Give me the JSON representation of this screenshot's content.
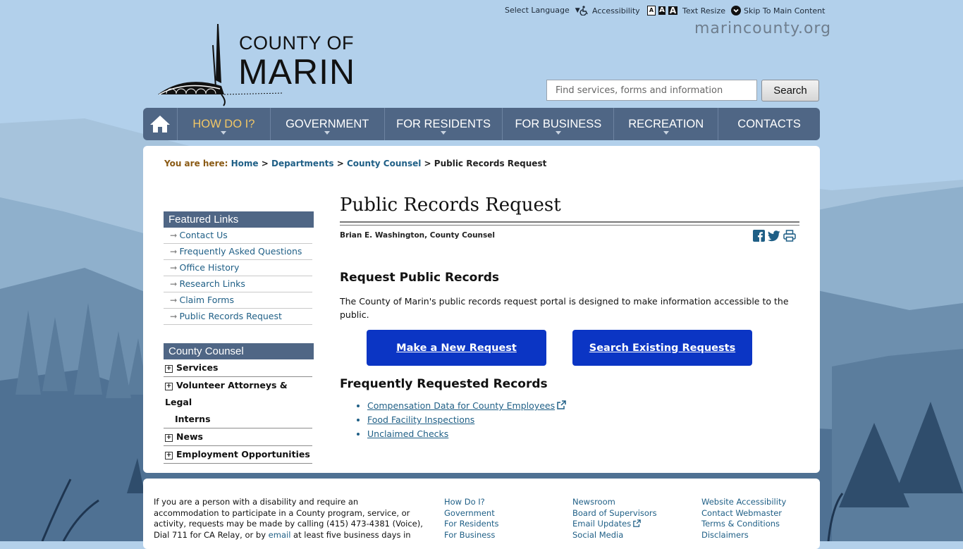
{
  "utility": {
    "language": "Select Language",
    "accessibility": "Accessibility",
    "text_resize": "Text Resize",
    "text_resize_letters": [
      "A",
      "A",
      "A"
    ],
    "skip": "Skip To Main Content"
  },
  "site": {
    "logo_line1": "COUNTY OF",
    "logo_line2": "MARIN",
    "domain": "marincounty.org"
  },
  "search": {
    "placeholder": "Find services, forms and information",
    "button": "Search"
  },
  "nav": {
    "home_icon": "home-icon",
    "items": [
      {
        "label": "HOW DO I?"
      },
      {
        "label": "GOVERNMENT"
      },
      {
        "label": "FOR RESIDENTS"
      },
      {
        "label": "FOR BUSINESS"
      },
      {
        "label": "RECREATION"
      },
      {
        "label": "CONTACTS"
      }
    ],
    "active_color": "#f2c766",
    "bar_color": "#4f6685"
  },
  "breadcrumb": {
    "label": "You are here:",
    "items": [
      "Home",
      "Departments",
      "County Counsel"
    ],
    "current": "Public Records Request",
    "sep": ">"
  },
  "sidebar": {
    "featured_title": "Featured Links",
    "featured": [
      "Contact Us",
      "Frequently Asked Questions",
      "Office History",
      "Research Links",
      "Claim Forms",
      "Public Records Request"
    ],
    "counsel_title": "County Counsel",
    "counsel": [
      "Services",
      "Volunteer Attorneys & Legal",
      "Interns",
      "News",
      "Employment Opportunities"
    ]
  },
  "content": {
    "title": "Public Records Request",
    "byline": "Brian E. Washington, County Counsel",
    "share_icons": [
      "facebook-icon",
      "twitter-icon",
      "print-icon"
    ],
    "request_heading": "Request Public Records",
    "request_desc": "The County of Marin's public records request portal is designed to make information accessible to the public.",
    "new_request": "Make a New Request",
    "search_requests": "Search Existing Requests",
    "button_color": "#0b35c4",
    "freq_heading": "Frequently Requested Records",
    "freq_items": [
      "Compensation Data for County Employees",
      "Food Facility Inspections",
      "Unclaimed Checks"
    ]
  },
  "footer": {
    "text_before": "If you are a person with a disability and require an accommodation to participate in a County program, service, or activity, requests may be made by calling (415) 473-4381 (Voice), Dial 711 for CA Relay, or by ",
    "text_link": "email",
    "text_after": " at least five business days in",
    "col1": [
      "How Do I?",
      "Government",
      "For Residents",
      "For Business"
    ],
    "col2": [
      "Newsroom",
      "Board of Supervisors",
      "Email Updates",
      "Social Media"
    ],
    "col3": [
      "Website Accessibility",
      "Contact Webmaster",
      "Terms & Conditions",
      "Disclaimers"
    ]
  }
}
